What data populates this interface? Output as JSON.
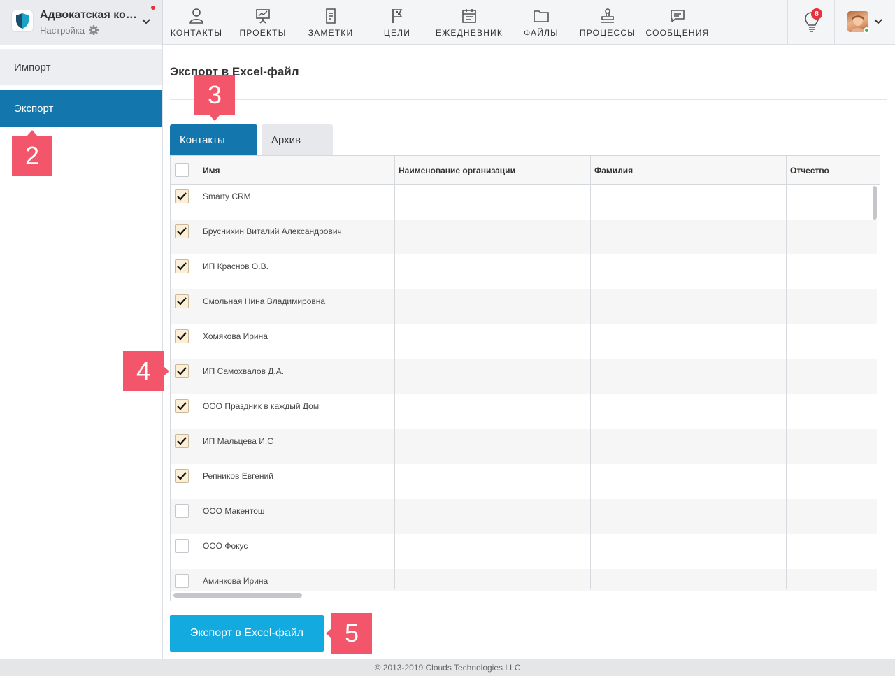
{
  "brand": {
    "title": "Адвокатская кон...",
    "subtitle": "Настройка"
  },
  "nav": [
    {
      "label": "КОНТАКТЫ",
      "icon": "person-icon"
    },
    {
      "label": "ПРОЕКТЫ",
      "icon": "presentation-icon"
    },
    {
      "label": "ЗАМЕТКИ",
      "icon": "notes-icon"
    },
    {
      "label": "ЦЕЛИ",
      "icon": "flag-icon"
    },
    {
      "label": "ЕЖЕДНЕВНИК",
      "icon": "calendar-icon"
    },
    {
      "label": "ФАЙЛЫ",
      "icon": "folder-icon"
    },
    {
      "label": "ПРОЦЕССЫ",
      "icon": "stamp-icon"
    },
    {
      "label": "СООБЩЕНИЯ",
      "icon": "chat-icon"
    }
  ],
  "notifications": {
    "count": "8"
  },
  "sidebar": {
    "items": [
      {
        "label": "Импорт"
      },
      {
        "label": "Экспорт"
      }
    ]
  },
  "main": {
    "title": "Экспорт в Excel-файл",
    "tabs": [
      {
        "label": "Контакты"
      },
      {
        "label": "Архив"
      }
    ],
    "columns": [
      "Имя",
      "Наименование организации",
      "Фамилия",
      "Отчество"
    ],
    "rows": [
      {
        "name": "Smarty CRM",
        "checked": true
      },
      {
        "name": "Бруснихин Виталий Александрович",
        "checked": true
      },
      {
        "name": "ИП Краснов О.В.",
        "checked": true
      },
      {
        "name": "Смольная Нина Владимировна",
        "checked": true
      },
      {
        "name": "Хомякова Ирина",
        "checked": true
      },
      {
        "name": "ИП Самохвалов Д.А.",
        "checked": true
      },
      {
        "name": "ООО Праздник в каждый Дом",
        "checked": true
      },
      {
        "name": "ИП Мальцева И.С",
        "checked": true
      },
      {
        "name": "Репников Евгений",
        "checked": true
      },
      {
        "name": "ООО Макентош",
        "checked": false
      },
      {
        "name": "ООО Фокус",
        "checked": false
      },
      {
        "name": "Аминкова Ирина",
        "checked": false
      }
    ],
    "export_button": "Экспорт в Excel-файл"
  },
  "markers": [
    "2",
    "3",
    "4",
    "5"
  ],
  "footer": "© 2013-2019 Clouds Technologies LLC",
  "colors": {
    "accent": "#1377ad",
    "button": "#13aae0",
    "marker": "#f3566a",
    "badge": "#e5323c"
  }
}
